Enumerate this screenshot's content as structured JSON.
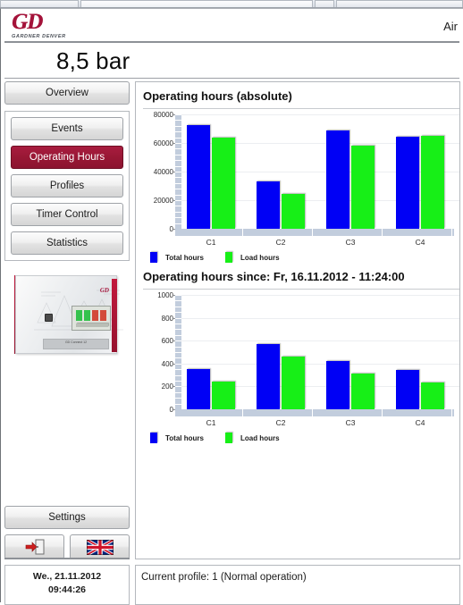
{
  "window": {
    "header_right_text": "Air",
    "logo_text": "GD",
    "logo_subtext": "GARDNER DENVER",
    "logo_color": "#a4133a"
  },
  "pressure": {
    "value": "8,5 bar"
  },
  "sidebar": {
    "overview_label": "Overview",
    "nav_items": [
      {
        "label": "Events",
        "active": false
      },
      {
        "label": "Operating Hours",
        "active": true
      },
      {
        "label": "Profiles",
        "active": false
      },
      {
        "label": "Timer Control",
        "active": false
      },
      {
        "label": "Statistics",
        "active": false
      }
    ],
    "device_image_name": "gd-connect-12-controller",
    "device_image_caption": "GD Connect 12",
    "settings_label": "Settings",
    "logout_icon": "exit-door-icon",
    "language_icon": "uk-flag-icon"
  },
  "datetime": {
    "date": "We., 21.11.2012",
    "time": "09:44:26"
  },
  "statusbar": {
    "text": "Current profile: 1 (Normal operation)"
  },
  "colors": {
    "total_hours": "#0000f5",
    "load_hours": "#17ef17",
    "active_button": "#a81c3f",
    "axis_band": "#c2cddd"
  },
  "chart_data": [
    {
      "type": "bar",
      "title": "Operating hours (absolute)",
      "categories": [
        "C1",
        "C2",
        "C3",
        "C4"
      ],
      "series": [
        {
          "name": "Total hours",
          "color": "#0000f5",
          "values": [
            72500,
            33000,
            68500,
            64500
          ]
        },
        {
          "name": "Load hours",
          "color": "#17ef17",
          "values": [
            64000,
            24500,
            58000,
            65000
          ]
        }
      ],
      "ylim": [
        0,
        80000
      ],
      "yticks": [
        0,
        20000,
        40000,
        60000,
        80000
      ],
      "ytick_labels": [
        "0",
        "20000",
        "40000",
        "60000",
        "80000"
      ],
      "xlabel": "",
      "ylabel": "",
      "grid": true,
      "legend_position": "bottom-left"
    },
    {
      "type": "bar",
      "title": "Operating hours since: Fr, 16.11.2012 - 11:24:00",
      "categories": [
        "C1",
        "C2",
        "C3",
        "C4"
      ],
      "series": [
        {
          "name": "Total hours",
          "color": "#0000f5",
          "values": [
            355,
            570,
            420,
            340
          ]
        },
        {
          "name": "Load hours",
          "color": "#17ef17",
          "values": [
            240,
            460,
            315,
            235
          ]
        }
      ],
      "ylim": [
        0,
        1000
      ],
      "yticks": [
        0,
        200,
        400,
        600,
        800,
        1000
      ],
      "ytick_labels": [
        "0",
        "200",
        "400",
        "600",
        "800",
        "1000"
      ],
      "xlabel": "",
      "ylabel": "",
      "grid": true,
      "legend_position": "bottom-left"
    }
  ]
}
